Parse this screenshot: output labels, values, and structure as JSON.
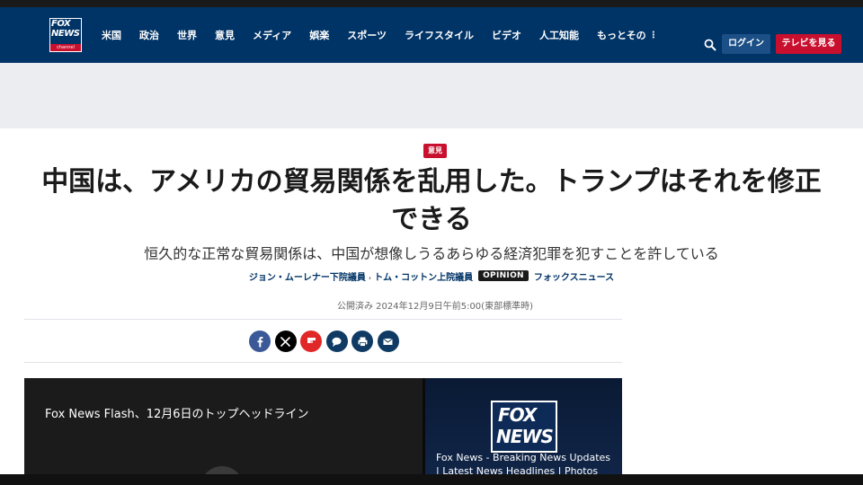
{
  "header": {
    "logo": {
      "line1": "FOX",
      "line2": "NEWS",
      "channel": "channel"
    },
    "nav": [
      "米国",
      "政治",
      "世界",
      "意見",
      "メディア",
      "娯楽",
      "スポーツ",
      "ライフスタイル",
      "ビデオ",
      "人工知能"
    ],
    "nav_more": "もっとその",
    "nav_more_icon": "vertical-dots-icon",
    "search_icon": "search-icon",
    "login_label": "ログイン",
    "watch_tv_label": "テレビを見る"
  },
  "article": {
    "category_badge": "意見",
    "headline": "中国は、アメリカの貿易関係を乱用した。トランプはそれを修正できる",
    "subheadline": "恒久的な正常な貿易関係は、中国が想像しうるあらゆる経済犯罪を犯すことを許している",
    "authors": [
      "ジョン・ムーレナー下院議員",
      "トム・コットン上院議員"
    ],
    "author_separator": ",",
    "opinion_tag": "OPINION",
    "outlet": "フォックスニュース",
    "published": "公開済み 2024年12月9日午前5:00(東部標準時)"
  },
  "share": [
    {
      "name": "facebook",
      "icon": "facebook-icon",
      "color": "#3b5998"
    },
    {
      "name": "x",
      "icon": "x-icon",
      "color": "#000000"
    },
    {
      "name": "flipboard",
      "icon": "flipboard-icon",
      "color": "#e12828"
    },
    {
      "name": "comments",
      "icon": "comment-icon",
      "color": "#0f3a64"
    },
    {
      "name": "print",
      "icon": "print-icon",
      "color": "#0f3a64"
    },
    {
      "name": "email",
      "icon": "email-icon",
      "color": "#0f3a64"
    }
  ],
  "video": {
    "main_title": "Fox News Flash、12月6日のトップヘッドライン",
    "side_logo": {
      "line1": "FOX",
      "line2": "NEWS"
    },
    "side_title": "Fox News - Breaking News Updates | Latest News Headlines | Photos &..."
  },
  "colors": {
    "nav_bg": "#003366",
    "accent_red": "#c8102e",
    "login_bg": "#1b4f86",
    "ad_band": "#ecedf0"
  }
}
